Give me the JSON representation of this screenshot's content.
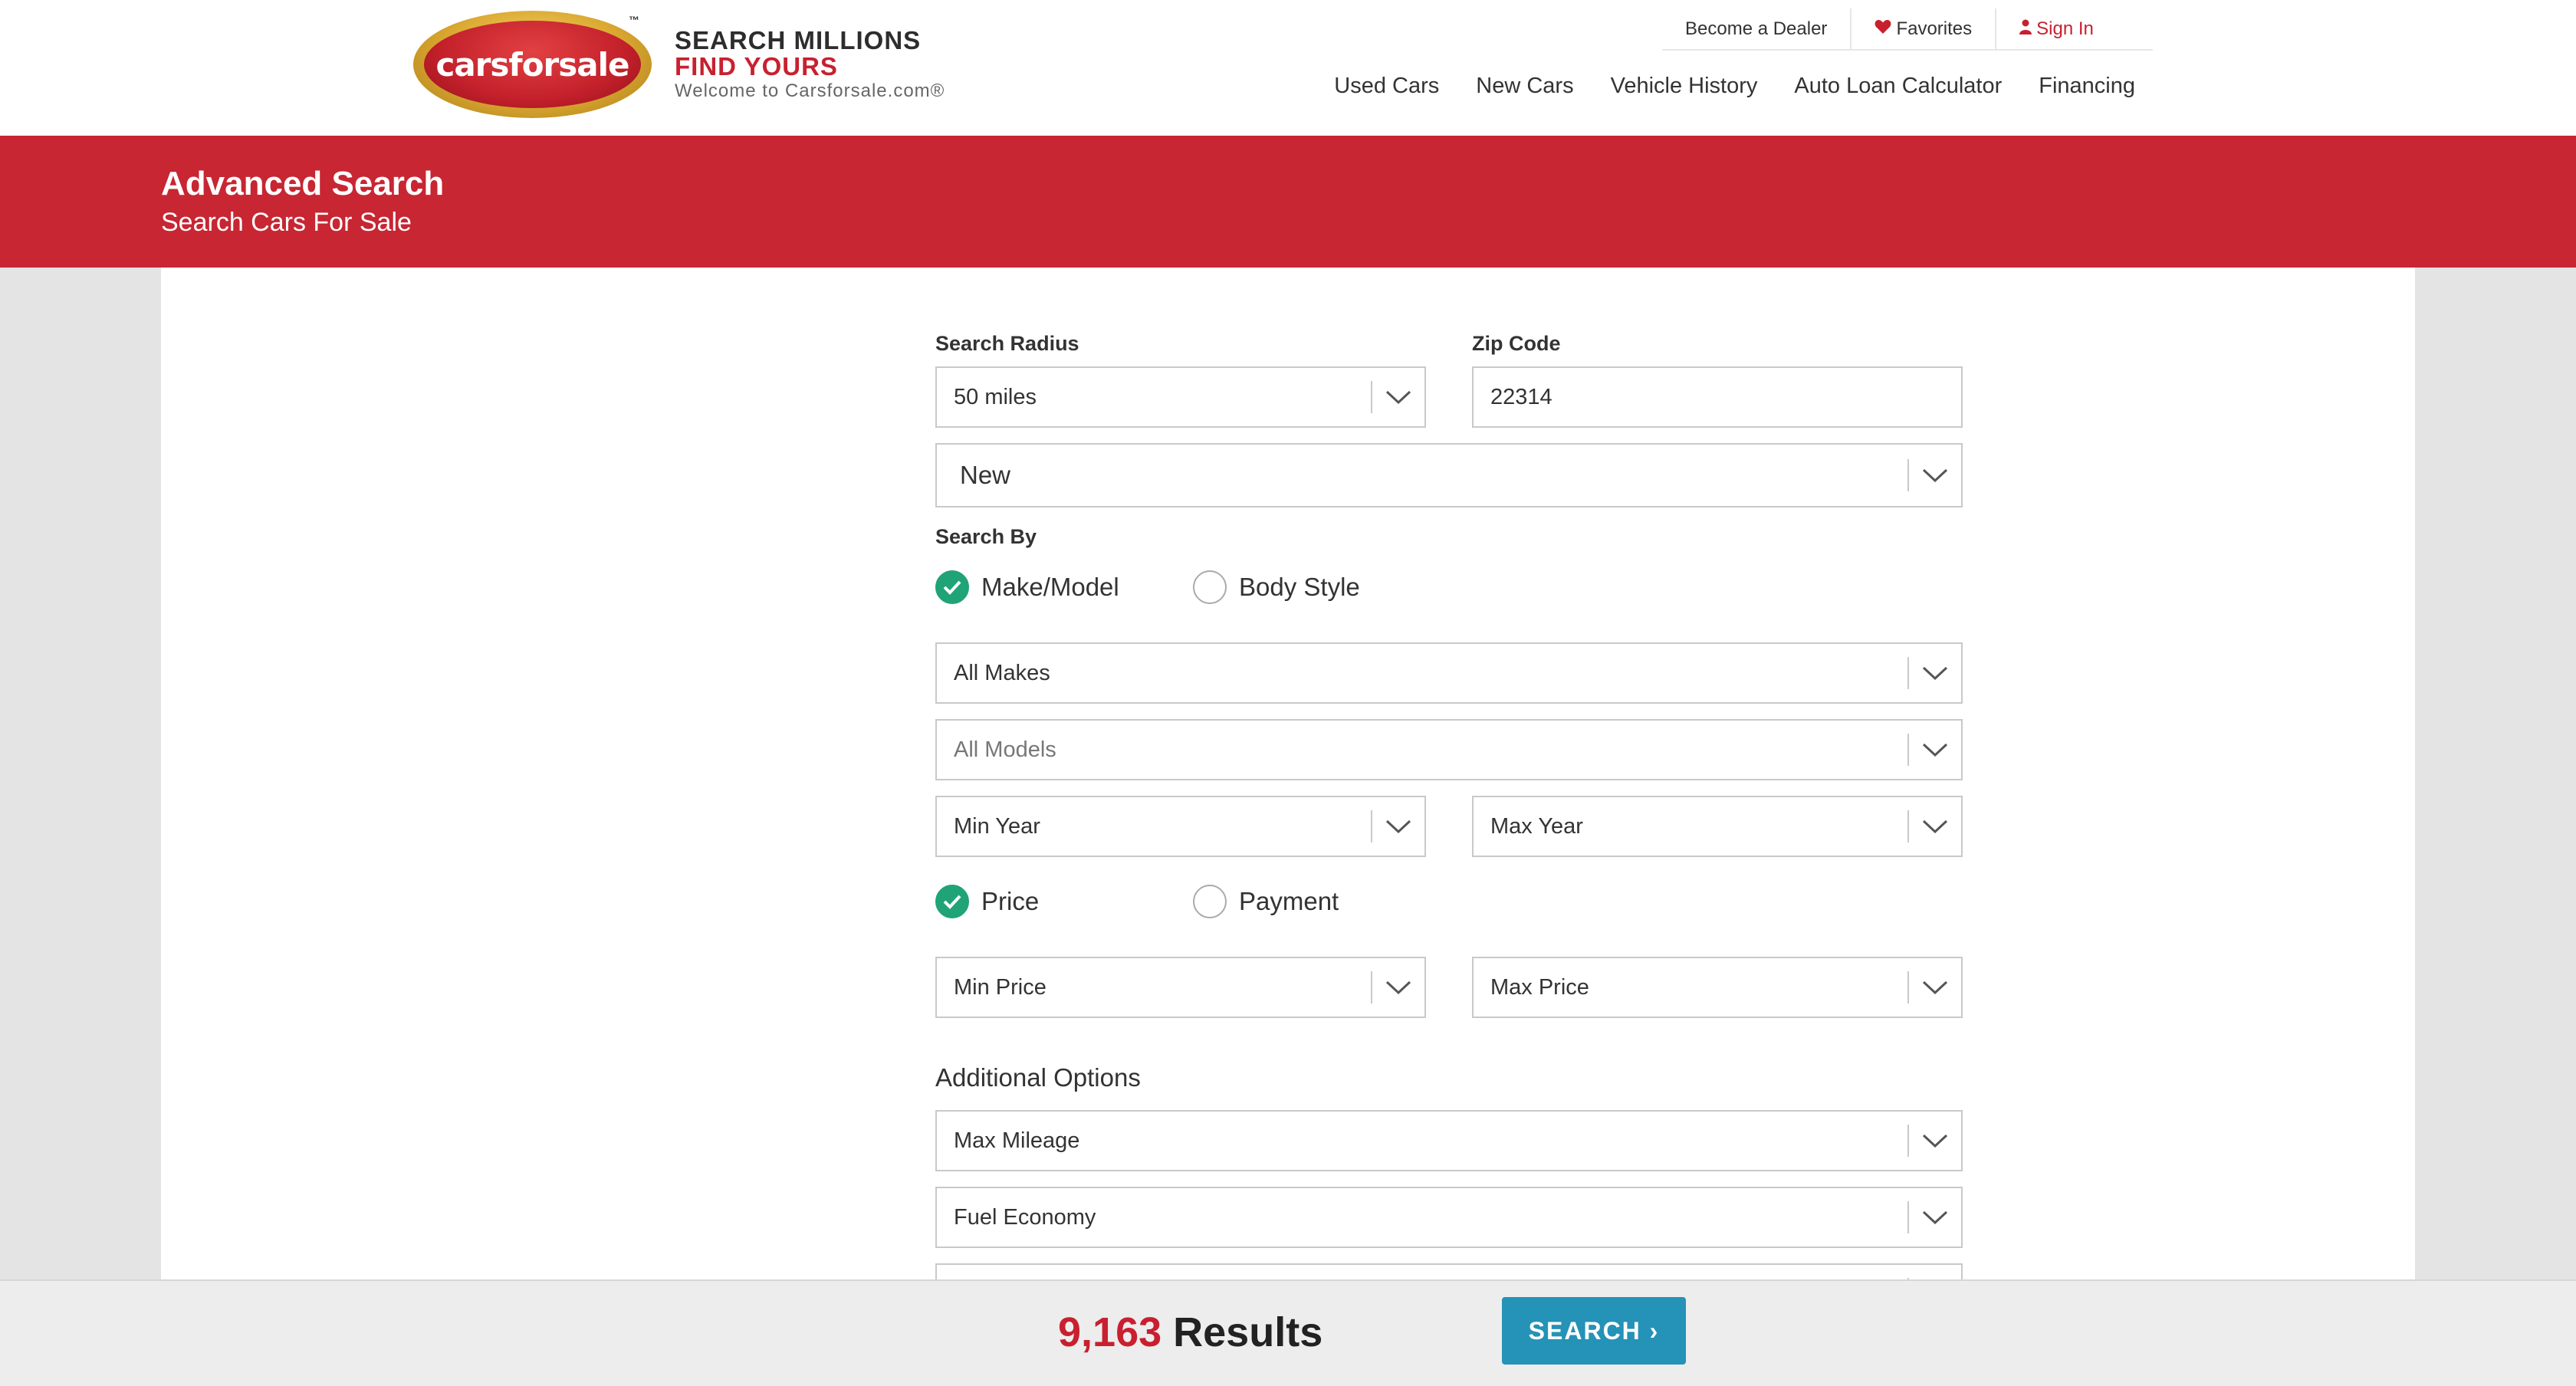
{
  "header": {
    "logo_text": "carsforsale",
    "logo_tm": "™",
    "tagline_1": "SEARCH MILLIONS",
    "tagline_2": "FIND YOURS",
    "tagline_3": "Welcome to Carsforsale.com®",
    "top_links": {
      "dealer": "Become a Dealer",
      "favorites": "Favorites",
      "signin": "Sign In"
    },
    "nav": [
      "Used Cars",
      "New Cars",
      "Vehicle History",
      "Auto Loan Calculator",
      "Financing"
    ]
  },
  "banner": {
    "title": "Advanced Search",
    "subtitle": "Search Cars For Sale"
  },
  "form": {
    "radius_label": "Search Radius",
    "radius_value": "50 miles",
    "zip_label": "Zip Code",
    "zip_value": "22314",
    "condition_value": "New",
    "search_by_label": "Search By",
    "make_model_label": "Make/Model",
    "body_style_label": "Body Style",
    "makes_value": "All Makes",
    "models_value": "All Models",
    "min_year": "Min Year",
    "max_year": "Max Year",
    "price_label": "Price",
    "payment_label": "Payment",
    "min_price": "Min Price",
    "max_price": "Max Price",
    "additional_label": "Additional Options",
    "max_mileage": "Max Mileage",
    "fuel_economy": "Fuel Economy"
  },
  "footer": {
    "result_count": "9,163",
    "result_word": "Results",
    "search_button": "SEARCH ›"
  },
  "colors": {
    "brand_red": "#c72632",
    "check_green": "#20a377",
    "search_blue": "#2592b7"
  }
}
